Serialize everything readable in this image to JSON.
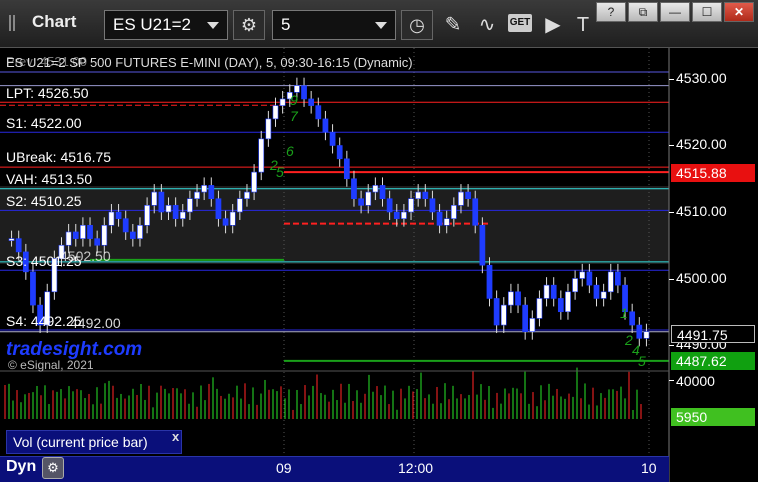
{
  "titlebar": {
    "title": "Chart",
    "symbol": "ES U21=2",
    "interval": "5",
    "icons": [
      "settings-gear-icon",
      "clock-icon",
      "pencil-icon",
      "indicator-icon",
      "get-icon",
      "play-icon",
      "text-icon"
    ],
    "get_label": "GET",
    "win_controls": [
      "?",
      "⧉",
      "—",
      "☐",
      "✕"
    ]
  },
  "chart": {
    "header": "ES U21=2 SP 500 FUTURES E-MINI (DAY), 5, 09:30-16:15 (Dynamic)",
    "header_overlap": "Prev: 4531.00",
    "levels": [
      {
        "label": "LPT: 4526.50",
        "price": 4526.5,
        "color": "#ff2020"
      },
      {
        "label": "S1: 4522.00",
        "price": 4522.0,
        "color": "#2828e0"
      },
      {
        "label": "UBreak: 4516.75",
        "price": 4516.75,
        "color": "#ff2020"
      },
      {
        "label": "VAH: 4513.50",
        "price": 4513.5,
        "color": "#33e0e0"
      },
      {
        "label": "S2: 4510.25",
        "price": 4510.25,
        "color": "#2828e0"
      },
      {
        "label": "S3: 4501.25",
        "price": 4501.25,
        "color": "#2828e0"
      },
      {
        "label": "S4: 4492.25",
        "price": 4492.25,
        "color": "#2828e0"
      }
    ],
    "overlap_texts": [
      "4502.50",
      "4492.00"
    ],
    "watermark": "tradesight.com",
    "copyright": "© eSignal, 2021",
    "price_axis": [
      "4530.00",
      "4520.00",
      "4510.00",
      "4500.00",
      "4490.00"
    ],
    "price_badges": [
      {
        "value": "4515.88",
        "bg": "#e81010",
        "fg": "#ffffff"
      },
      {
        "value": "4491.75",
        "bg": "#000000",
        "fg": "#ffffff"
      },
      {
        "value": "4487.62",
        "bg": "#10a010",
        "fg": "#ffffff"
      }
    ],
    "time_axis": [
      "09",
      "12:00",
      "10"
    ],
    "volume_axis": "40000",
    "volume_badge": {
      "value": "5950",
      "bg": "#40c020",
      "fg": "#ffffff"
    },
    "volume_label": "Vol (current price bar)",
    "volume_close": "x",
    "bottom_label": "Dyn",
    "markers": [
      "9",
      "7",
      "6",
      "2",
      "5",
      "1",
      "2",
      "4",
      "5"
    ]
  }
}
